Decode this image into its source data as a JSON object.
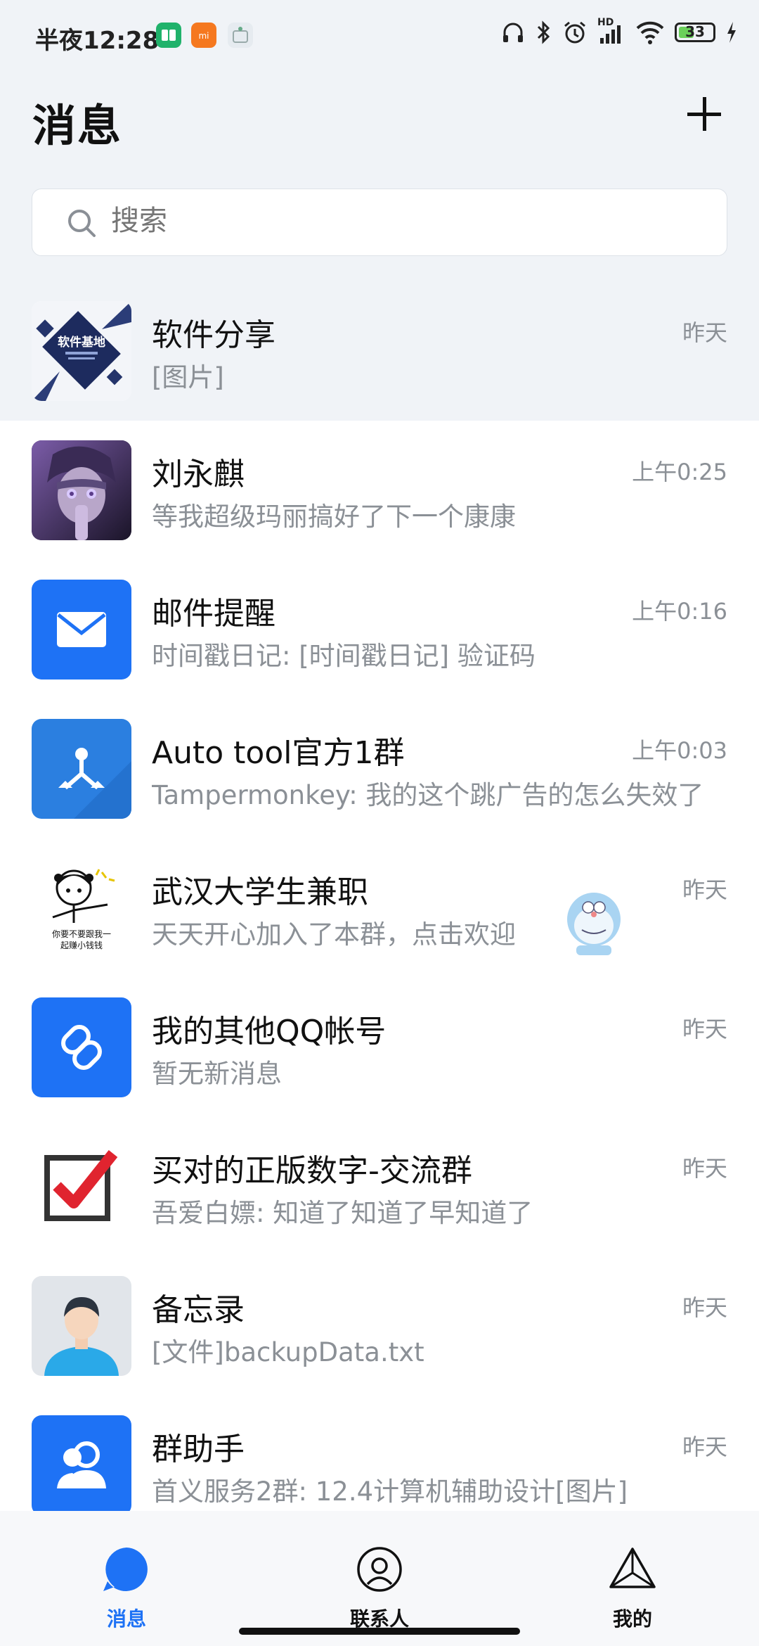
{
  "status_bar": {
    "time": "半夜12:28",
    "battery": "33",
    "signal_label": "HD"
  },
  "header": {
    "title": "消息"
  },
  "search": {
    "placeholder": "搜索"
  },
  "conversations": [
    {
      "name": "软件分享",
      "message": "[图片]",
      "time": "昨天",
      "avatar_icon": "software-share-logo"
    },
    {
      "name": "刘永麒",
      "message": "等我超级玛丽搞好了下一个康康",
      "time": "上午0:25",
      "avatar_icon": "ninja-avatar"
    },
    {
      "name": "邮件提醒",
      "message": "时间戳日记: [时间戳日记] 验证码",
      "time": "上午0:16",
      "avatar_icon": "mail-icon"
    },
    {
      "name": "Auto tool官方1群",
      "message": "Tampermonkey: 我的这个跳广告的怎么失效了",
      "time": "上午0:03",
      "avatar_icon": "share-nodes-icon"
    },
    {
      "name": "武汉大学生兼职",
      "message": "天天开心加入了本群，点击欢迎",
      "time": "昨天",
      "avatar_icon": "cartoon-girl-avatar"
    },
    {
      "name": "我的其他QQ帐号",
      "message": "暂无新消息",
      "time": "昨天",
      "avatar_icon": "link-icon"
    },
    {
      "name": "买对的正版数字-交流群",
      "message": "吾爱白嫖: 知道了知道了早知道了",
      "time": "昨天",
      "avatar_icon": "checkbox-icon"
    },
    {
      "name": "备忘录",
      "message": "[文件]backupData.txt",
      "time": "昨天",
      "avatar_icon": "person-avatar"
    },
    {
      "name": "群助手",
      "message": "首义服务2群: 12.4计算机辅助设计[图片]",
      "time": "昨天",
      "avatar_icon": "group-icon"
    }
  ],
  "avatar_text": {
    "software_logo": "软件基地",
    "sticker_caption_1": "你要不要跟我一",
    "sticker_caption_2": "起赚小钱钱"
  },
  "tabs": [
    {
      "label": "消息",
      "active": true
    },
    {
      "label": "联系人",
      "active": false
    },
    {
      "label": "我的",
      "active": false
    }
  ],
  "colors": {
    "accent": "#1e72f5",
    "header_bg": "#f0f3f7",
    "secondary_text": "#8b9096"
  }
}
